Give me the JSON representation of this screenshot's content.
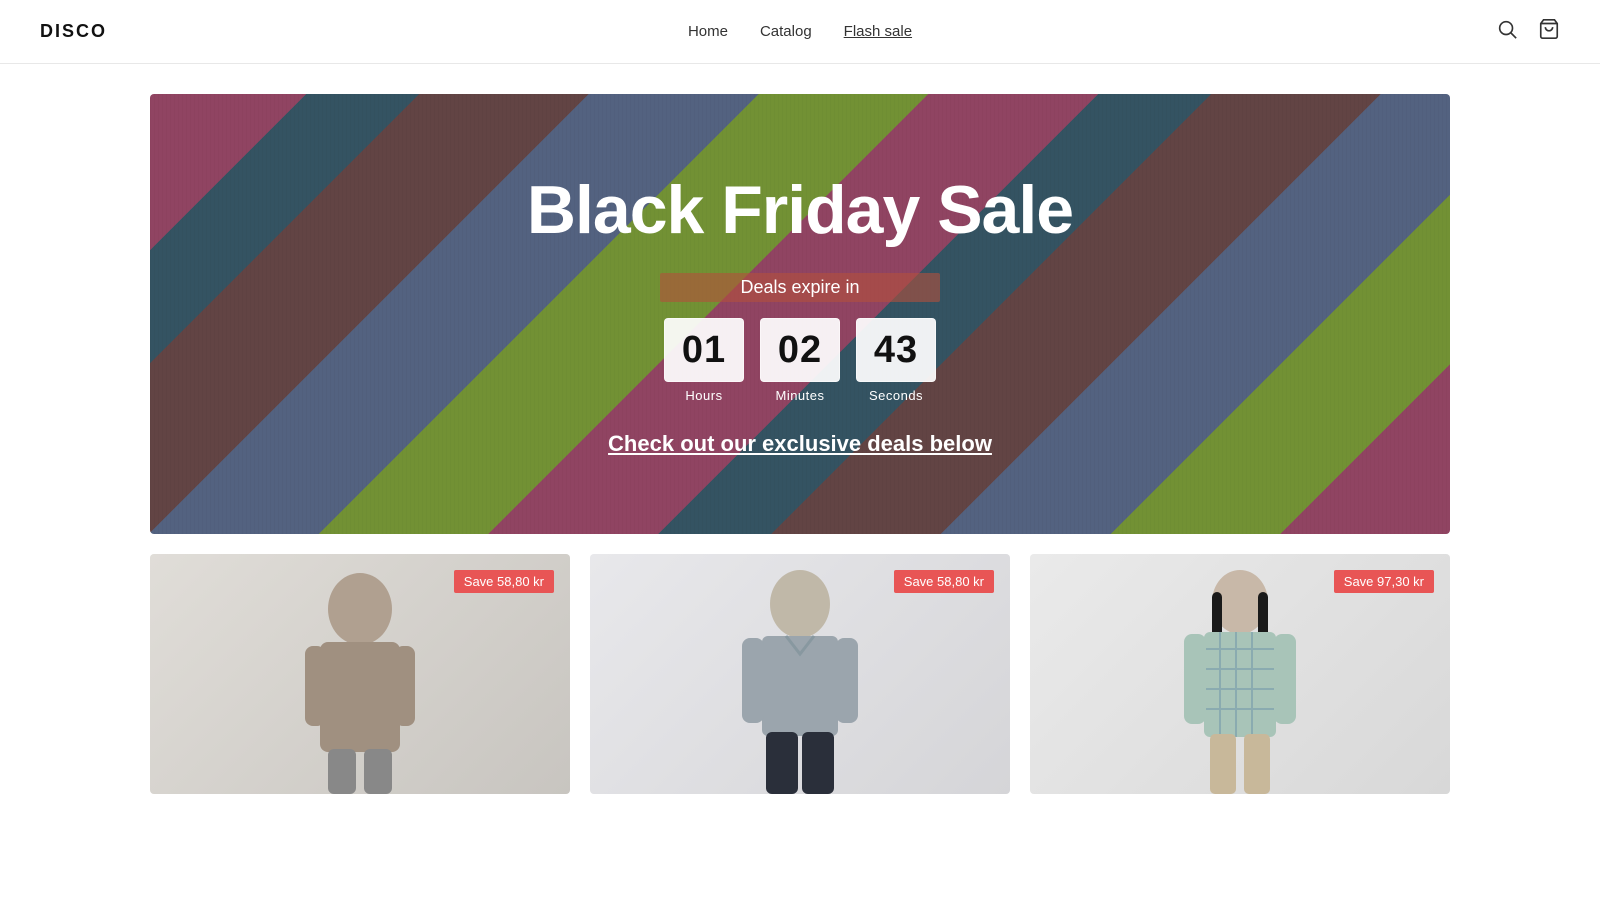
{
  "header": {
    "logo": "DISCO",
    "nav": [
      {
        "label": "Home",
        "active": false
      },
      {
        "label": "Catalog",
        "active": false
      },
      {
        "label": "Flash sale",
        "active": true
      }
    ]
  },
  "hero": {
    "title": "Black Friday Sale",
    "deals_expire_label": "Deals expire in",
    "countdown": {
      "hours": {
        "value": "01",
        "label": "Hours"
      },
      "minutes": {
        "value": "02",
        "label": "Minutes"
      },
      "seconds": {
        "value": "43",
        "label": "Seconds"
      }
    },
    "cta": "Check out our exclusive deals below"
  },
  "products": [
    {
      "save_badge": "Save 58,80 kr",
      "alt": "Man in grey turtleneck, side view"
    },
    {
      "save_badge": "Save 58,80 kr",
      "alt": "Man in grey button-up shirt, front"
    },
    {
      "save_badge": "Save 97,30 kr",
      "alt": "Woman in light blue plaid shirt"
    }
  ]
}
